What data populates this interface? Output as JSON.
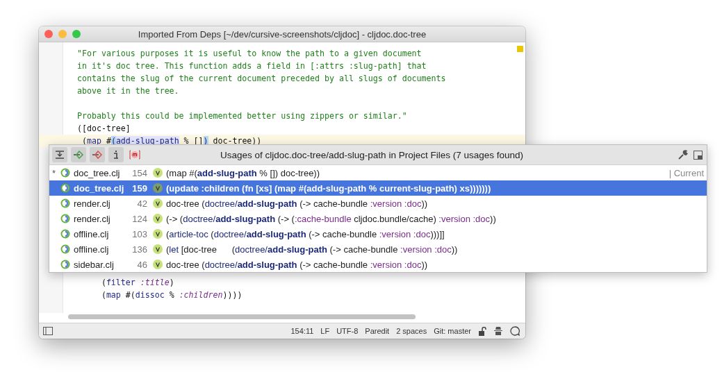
{
  "window": {
    "title": "Imported From Deps [~/dev/cursive-screenshots/cljdoc] - cljdoc.doc-tree"
  },
  "editor": {
    "lines_top": [
      {
        "current": false,
        "tokens": [
          {
            "text": "\"For various purposes it is useful to know the path to a given document",
            "kind": "string"
          }
        ]
      },
      {
        "current": false,
        "tokens": [
          {
            "text": "in it's doc tree. This function adds a field in [:attrs :slug-path] that",
            "kind": "string"
          }
        ]
      },
      {
        "current": false,
        "tokens": [
          {
            "text": "contains the slug of the current document preceded by all slugs of documents",
            "kind": "string"
          }
        ]
      },
      {
        "current": false,
        "tokens": [
          {
            "text": "above it in the tree.",
            "kind": "string"
          }
        ]
      },
      {
        "current": false
      },
      {
        "current": false,
        "tokens": [
          {
            "text": "Probably this could be implemented better using zippers or similar.\"",
            "kind": "string"
          }
        ]
      },
      {
        "current": false,
        "tokens": [
          {
            "text": "([doc-tree]",
            "kind": "plain"
          }
        ]
      },
      {
        "current": true,
        "tokens": [
          {
            "text": " (",
            "kind": "plain"
          },
          {
            "text": "map",
            "kind": "fn"
          },
          {
            "text": " #",
            "kind": "plain"
          },
          {
            "text": "(",
            "kind": "match"
          },
          {
            "text": "add-slug-path",
            "kind": "usage"
          },
          {
            "text": " % []",
            "kind": "plain"
          },
          {
            "text": ")",
            "kind": "match"
          },
          {
            "text": " doc-tree))",
            "kind": "plain"
          }
        ]
      }
    ],
    "lines_bottom": [
      {
        "current": false,
        "tokens": [
          {
            "text": "     (",
            "kind": "plain"
          },
          {
            "text": "filter",
            "kind": "fn"
          },
          {
            "text": " :title",
            "kind": "kw"
          },
          {
            "text": ")",
            "kind": "plain"
          }
        ]
      },
      {
        "current": false,
        "tokens": [
          {
            "text": "     (",
            "kind": "plain"
          },
          {
            "text": "map",
            "kind": "fn"
          },
          {
            "text": " #(",
            "kind": "plain"
          },
          {
            "text": "dissoc",
            "kind": "fn"
          },
          {
            "text": " % ",
            "kind": "plain"
          },
          {
            "text": ":children",
            "kind": "kw"
          },
          {
            "text": "))))",
            "kind": "plain"
          }
        ]
      }
    ]
  },
  "usages": {
    "title": "Usages of cljdoc.doc-tree/add-slug-path in Project Files (7 usages found)",
    "rows": [
      {
        "marker": "*",
        "file": "doc_tree.clj",
        "line": "154",
        "selected": false,
        "tag": "| Current",
        "code": [
          {
            "text": "(map #(",
            "kind": "plain"
          },
          {
            "text": "add-slug-path",
            "kind": "bold"
          },
          {
            "text": " % []) doc-tree))",
            "kind": "plain"
          }
        ]
      },
      {
        "file": "doc_tree.clj",
        "line": "159",
        "selected": true,
        "code": [
          {
            "text": "(update :children (fn [xs] (map #(",
            "kind": "plain"
          },
          {
            "text": "add-slug-path",
            "kind": "bold"
          },
          {
            "text": " % current-slug-path) xs)))))))",
            "kind": "plain"
          }
        ]
      },
      {
        "file": "render.clj",
        "line": "42",
        "selected": false,
        "code": [
          {
            "text": "doc-tree (",
            "kind": "plain"
          },
          {
            "text": "doctree/",
            "kind": "ns"
          },
          {
            "text": "add-slug-path",
            "kind": "bold"
          },
          {
            "text": " (-> cache-bundle ",
            "kind": "plain"
          },
          {
            "text": ":version :doc",
            "kind": "kw"
          },
          {
            "text": "))",
            "kind": "plain"
          }
        ]
      },
      {
        "file": "render.clj",
        "line": "124",
        "selected": false,
        "code": [
          {
            "text": "(-> (",
            "kind": "plain"
          },
          {
            "text": "doctree/",
            "kind": "ns"
          },
          {
            "text": "add-slug-path",
            "kind": "bold"
          },
          {
            "text": " (-> (",
            "kind": "plain"
          },
          {
            "text": ":cache-bundle",
            "kind": "kw"
          },
          {
            "text": " cljdoc.bundle/cache) ",
            "kind": "plain"
          },
          {
            "text": ":version :doc",
            "kind": "kw"
          },
          {
            "text": "))",
            "kind": "plain"
          }
        ]
      },
      {
        "file": "offline.clj",
        "line": "103",
        "selected": false,
        "code": [
          {
            "text": "(",
            "kind": "plain"
          },
          {
            "text": "article-toc",
            "kind": "ns"
          },
          {
            "text": " (",
            "kind": "plain"
          },
          {
            "text": "doctree/",
            "kind": "ns"
          },
          {
            "text": "add-slug-path",
            "kind": "bold"
          },
          {
            "text": " (-> cache-bundle ",
            "kind": "plain"
          },
          {
            "text": ":version :doc",
            "kind": "kw"
          },
          {
            "text": ")))]]",
            "kind": "plain"
          }
        ]
      },
      {
        "file": "offline.clj",
        "line": "136",
        "selected": false,
        "code": [
          {
            "text": "(",
            "kind": "plain"
          },
          {
            "text": "let",
            "kind": "ns"
          },
          {
            "text": " [doc-tree      (",
            "kind": "plain"
          },
          {
            "text": "doctree/",
            "kind": "ns"
          },
          {
            "text": "add-slug-path",
            "kind": "bold"
          },
          {
            "text": " (-> cache-bundle ",
            "kind": "plain"
          },
          {
            "text": ":version :doc",
            "kind": "kw"
          },
          {
            "text": "))",
            "kind": "plain"
          }
        ]
      },
      {
        "file": "sidebar.clj",
        "line": "46",
        "selected": false,
        "code": [
          {
            "text": "doc-tree (",
            "kind": "plain"
          },
          {
            "text": "doctree/",
            "kind": "ns"
          },
          {
            "text": "add-slug-path",
            "kind": "bold"
          },
          {
            "text": " (-> cache-bundle ",
            "kind": "plain"
          },
          {
            "text": ":version :doc",
            "kind": "kw"
          },
          {
            "text": "))",
            "kind": "plain"
          }
        ]
      }
    ]
  },
  "status_bar": {
    "items": [
      "154:11",
      "LF",
      "UTF-8",
      "Paredit",
      "2 spaces",
      "Git: master"
    ]
  }
}
